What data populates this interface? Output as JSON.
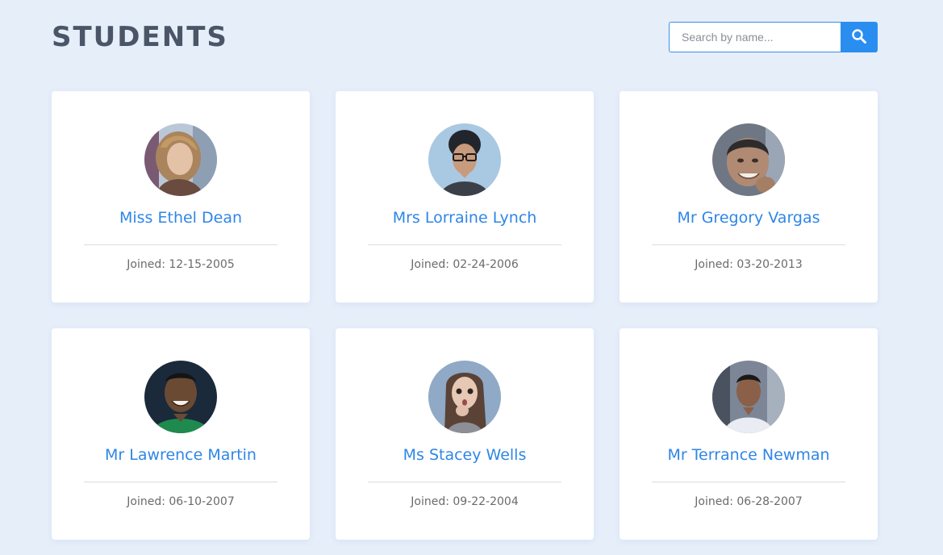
{
  "header": {
    "title": "STUDENTS"
  },
  "search": {
    "placeholder": "Search by name...",
    "value": "",
    "icon": "search-icon"
  },
  "colors": {
    "background": "#e6eefa",
    "accent": "#2a8ef0",
    "name": "#2f86e6",
    "title": "#4a5668"
  },
  "students": [
    {
      "name": "Miss Ethel Dean",
      "joined": "Joined: 12-15-2005",
      "avatar": "avatar-woman-blonde"
    },
    {
      "name": "Mrs Lorraine Lynch",
      "joined": "Joined: 02-24-2006",
      "avatar": "avatar-woman-glasses"
    },
    {
      "name": "Mr Gregory Vargas",
      "joined": "Joined: 03-20-2013",
      "avatar": "avatar-man-smiling"
    },
    {
      "name": "Mr Lawrence Martin",
      "joined": "Joined: 06-10-2007",
      "avatar": "avatar-man-green-shirt"
    },
    {
      "name": "Ms Stacey Wells",
      "joined": "Joined: 09-22-2004",
      "avatar": "avatar-woman-surprised"
    },
    {
      "name": "Mr Terrance Newman",
      "joined": "Joined: 06-28-2007",
      "avatar": "avatar-man-white-shirt"
    }
  ]
}
